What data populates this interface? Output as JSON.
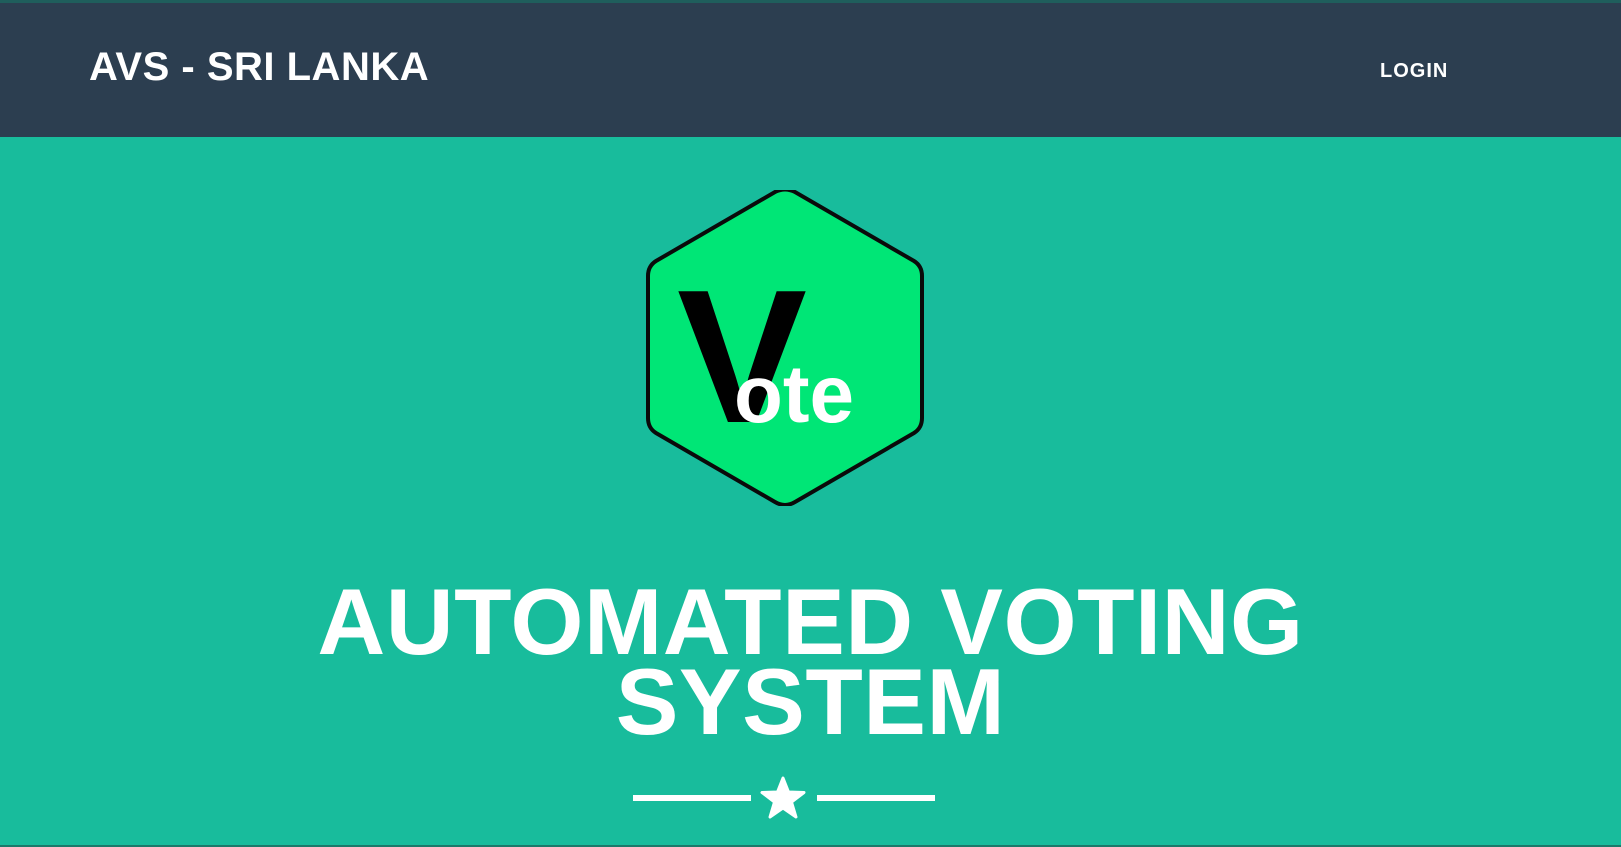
{
  "navbar": {
    "brand": "AVS - SRI LANKA",
    "login_label": "LOGIN"
  },
  "masthead": {
    "logo": {
      "letter_large": "V",
      "letters_small": "ote",
      "shape": "hexagon",
      "fill_color": "#00e676"
    },
    "title_line1": "AUTOMATED VOTING",
    "title_line2": "SYSTEM",
    "divider_icon": "star-icon"
  },
  "colors": {
    "navbar_bg": "#2c3e50",
    "masthead_bg": "#18bc9c",
    "logo_green": "#00e676",
    "text": "#ffffff"
  }
}
